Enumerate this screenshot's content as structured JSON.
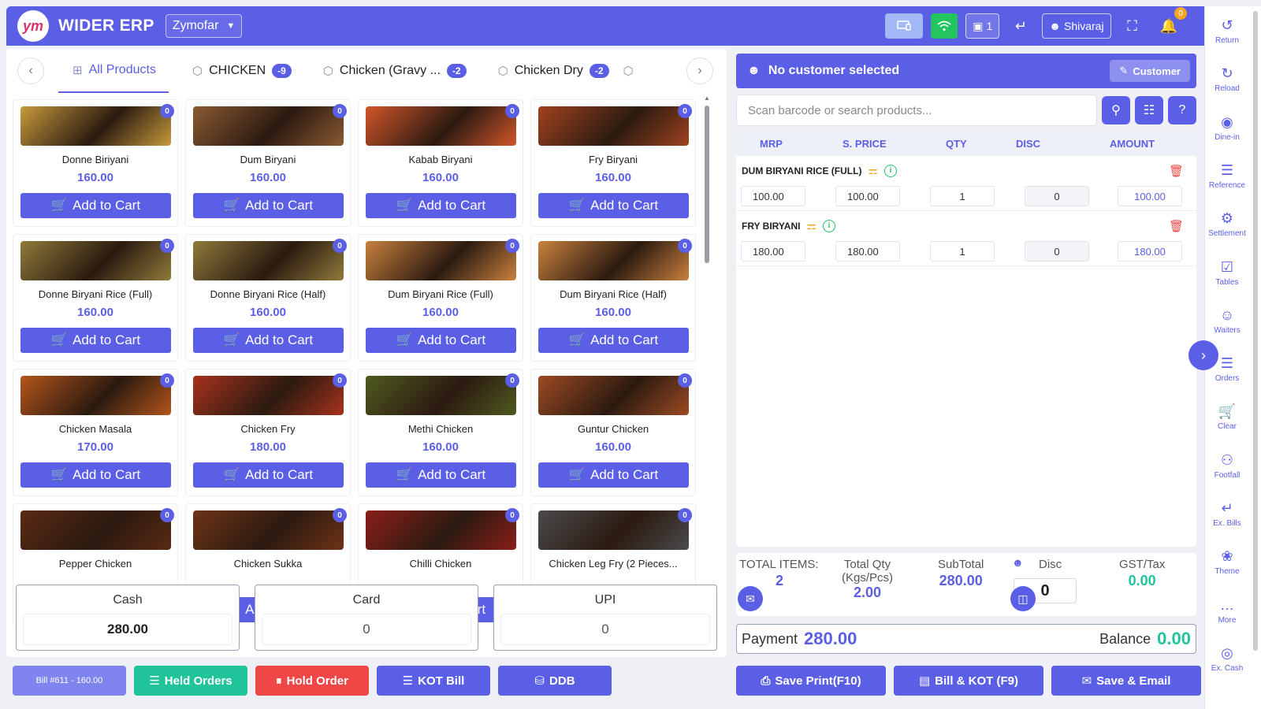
{
  "app": {
    "title": "WIDER ERP",
    "logo_text": "ym",
    "company": "Zymofar"
  },
  "topbar": {
    "table_count": "1",
    "user": "Shivaraj",
    "notif_count": "0"
  },
  "tabs": [
    {
      "label": "All Products",
      "badge": ""
    },
    {
      "label": "CHICKEN",
      "badge": "-9"
    },
    {
      "label": "Chicken (Gravy ...",
      "badge": "-2"
    },
    {
      "label": "Chicken Dry",
      "badge": "-2"
    }
  ],
  "products": [
    {
      "name": "Donne Biriyani",
      "price": "160.00",
      "stock": "0",
      "color": "#c79a3c"
    },
    {
      "name": "Dum Biryani",
      "price": "160.00",
      "stock": "0",
      "color": "#8a5a32"
    },
    {
      "name": "Kabab Biryani",
      "price": "160.00",
      "stock": "0",
      "color": "#d2562a"
    },
    {
      "name": "Fry Biryani",
      "price": "160.00",
      "stock": "0",
      "color": "#a0431f"
    },
    {
      "name": "Donne Biryani Rice (Full)",
      "price": "160.00",
      "stock": "0",
      "color": "#8f7a3a"
    },
    {
      "name": "Donne Biryani Rice (Half)",
      "price": "160.00",
      "stock": "0",
      "color": "#8f7a3a"
    },
    {
      "name": "Dum Biryani Rice (Full)",
      "price": "160.00",
      "stock": "0",
      "color": "#c9813e"
    },
    {
      "name": "Dum Biryani Rice (Half)",
      "price": "160.00",
      "stock": "0",
      "color": "#c9813e"
    },
    {
      "name": "Chicken Masala",
      "price": "170.00",
      "stock": "0",
      "color": "#b5551c"
    },
    {
      "name": "Chicken Fry",
      "price": "180.00",
      "stock": "0",
      "color": "#a8321d"
    },
    {
      "name": "Methi Chicken",
      "price": "160.00",
      "stock": "0",
      "color": "#4f5a1f"
    },
    {
      "name": "Guntur Chicken",
      "price": "160.00",
      "stock": "0",
      "color": "#9c4a22"
    },
    {
      "name": "Pepper Chicken",
      "price": "",
      "stock": "0",
      "color": "#5a2a14"
    },
    {
      "name": "Chicken Sukka",
      "price": "",
      "stock": "0",
      "color": "#6e3317"
    },
    {
      "name": "Chilli Chicken",
      "price": "",
      "stock": "0",
      "color": "#8a1f1a"
    },
    {
      "name": "Chicken Leg Fry (2 Pieces...",
      "price": "",
      "stock": "0",
      "color": "#4b4a4c"
    }
  ],
  "labels": {
    "add_to_cart": "Add to Cart",
    "no_customer": "No customer selected",
    "customer_btn": "Customer",
    "search_placeholder": "Scan barcode or search products...",
    "cash": "Cash",
    "card": "Card",
    "upi": "UPI",
    "total_items": "TOTAL ITEMS:",
    "total_qty": "Total Qty",
    "total_qty_unit": "(Kgs/Pcs)",
    "subtotal": "SubTotal",
    "disc": "Disc",
    "gst": "GST/Tax",
    "payment": "Payment",
    "balance": "Balance"
  },
  "table_headers": [
    "MRP",
    "S. PRICE",
    "QTY",
    "DISC",
    "AMOUNT"
  ],
  "cart": [
    {
      "name": "DUM BIRYANI RICE (FULL)",
      "mrp": "100.00",
      "sprice": "100.00",
      "qty": "1",
      "disc": "0",
      "amount": "100.00"
    },
    {
      "name": "FRY BIRYANI",
      "mrp": "180.00",
      "sprice": "180.00",
      "qty": "1",
      "disc": "0",
      "amount": "180.00"
    }
  ],
  "totals": {
    "items": "2",
    "qty": "2.00",
    "subtotal": "280.00",
    "disc": "0",
    "gst": "0.00",
    "payment": "280.00",
    "balance": "0.00"
  },
  "payments": {
    "cash": "280.00",
    "card": "0",
    "upi": "0"
  },
  "bottom_buttons": {
    "bill": "Bill #611 - 160.00",
    "held": "Held Orders",
    "hold": "Hold Order",
    "kot": "KOT Bill",
    "ddb": "DDB",
    "save_print": "Save Print(F10)",
    "bill_kot": "Bill & KOT (F9)",
    "save_email": "Save & Email"
  },
  "right_nav": [
    "Return",
    "Reload",
    "Dine-in",
    "Reference",
    "Settlement",
    "Tables",
    "Waiters",
    "Orders",
    "Clear",
    "Footfall",
    "Ex. Bills",
    "Theme",
    "More",
    "Ex. Cash"
  ],
  "right_nav_icons": [
    "return-icon",
    "reload-icon",
    "dine-in-icon",
    "reference-icon",
    "settlement-icon",
    "tables-icon",
    "waiters-icon",
    "orders-icon",
    "clear-cart-icon",
    "footfall-icon",
    "ex-bills-icon",
    "theme-icon",
    "more-icon",
    "ex-cash-icon"
  ],
  "colors": {
    "primary": "#5b5fe6",
    "green": "#22c55e",
    "teal": "#20c39a",
    "red": "#ef4646",
    "light_blue": "#7f84ee"
  }
}
